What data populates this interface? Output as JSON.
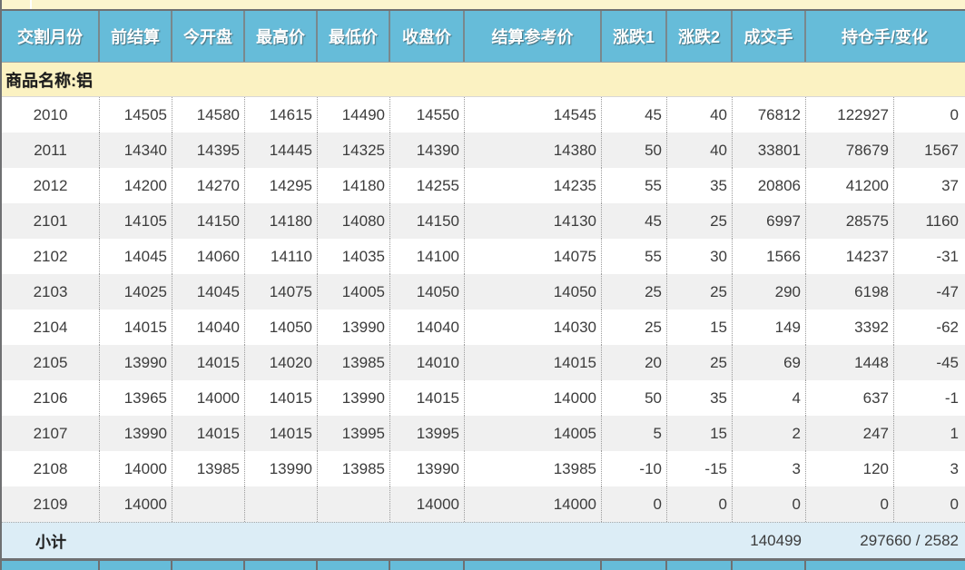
{
  "table": {
    "columns": [
      "交割月份",
      "前结算",
      "今开盘",
      "最高价",
      "最低价",
      "收盘价",
      "结算参考价",
      "涨跌1",
      "涨跌2",
      "成交手",
      "持仓手/变化"
    ],
    "product_label": "商品名称:铝",
    "rows": [
      {
        "month": "2010",
        "prev_settle": "14505",
        "open": "14580",
        "high": "14615",
        "low": "14490",
        "close": "14550",
        "settle_ref": "14545",
        "change1": "45",
        "change2": "40",
        "volume": "76812",
        "open_interest": "122927",
        "oi_change": "0"
      },
      {
        "month": "2011",
        "prev_settle": "14340",
        "open": "14395",
        "high": "14445",
        "low": "14325",
        "close": "14390",
        "settle_ref": "14380",
        "change1": "50",
        "change2": "40",
        "volume": "33801",
        "open_interest": "78679",
        "oi_change": "1567"
      },
      {
        "month": "2012",
        "prev_settle": "14200",
        "open": "14270",
        "high": "14295",
        "low": "14180",
        "close": "14255",
        "settle_ref": "14235",
        "change1": "55",
        "change2": "35",
        "volume": "20806",
        "open_interest": "41200",
        "oi_change": "37"
      },
      {
        "month": "2101",
        "prev_settle": "14105",
        "open": "14150",
        "high": "14180",
        "low": "14080",
        "close": "14150",
        "settle_ref": "14130",
        "change1": "45",
        "change2": "25",
        "volume": "6997",
        "open_interest": "28575",
        "oi_change": "1160"
      },
      {
        "month": "2102",
        "prev_settle": "14045",
        "open": "14060",
        "high": "14110",
        "low": "14035",
        "close": "14100",
        "settle_ref": "14075",
        "change1": "55",
        "change2": "30",
        "volume": "1566",
        "open_interest": "14237",
        "oi_change": "-31"
      },
      {
        "month": "2103",
        "prev_settle": "14025",
        "open": "14045",
        "high": "14075",
        "low": "14005",
        "close": "14050",
        "settle_ref": "14050",
        "change1": "25",
        "change2": "25",
        "volume": "290",
        "open_interest": "6198",
        "oi_change": "-47"
      },
      {
        "month": "2104",
        "prev_settle": "14015",
        "open": "14040",
        "high": "14050",
        "low": "13990",
        "close": "14040",
        "settle_ref": "14030",
        "change1": "25",
        "change2": "15",
        "volume": "149",
        "open_interest": "3392",
        "oi_change": "-62"
      },
      {
        "month": "2105",
        "prev_settle": "13990",
        "open": "14015",
        "high": "14020",
        "low": "13985",
        "close": "14010",
        "settle_ref": "14015",
        "change1": "20",
        "change2": "25",
        "volume": "69",
        "open_interest": "1448",
        "oi_change": "-45"
      },
      {
        "month": "2106",
        "prev_settle": "13965",
        "open": "14000",
        "high": "14015",
        "low": "13990",
        "close": "14015",
        "settle_ref": "14000",
        "change1": "50",
        "change2": "35",
        "volume": "4",
        "open_interest": "637",
        "oi_change": "-1"
      },
      {
        "month": "2107",
        "prev_settle": "13990",
        "open": "14015",
        "high": "14015",
        "low": "13995",
        "close": "13995",
        "settle_ref": "14005",
        "change1": "5",
        "change2": "15",
        "volume": "2",
        "open_interest": "247",
        "oi_change": "1"
      },
      {
        "month": "2108",
        "prev_settle": "14000",
        "open": "13985",
        "high": "13990",
        "low": "13985",
        "close": "13990",
        "settle_ref": "13985",
        "change1": "-10",
        "change2": "-15",
        "volume": "3",
        "open_interest": "120",
        "oi_change": "3"
      },
      {
        "month": "2109",
        "prev_settle": "14000",
        "open": "",
        "high": "",
        "low": "",
        "close": "14000",
        "settle_ref": "14000",
        "change1": "0",
        "change2": "0",
        "volume": "0",
        "open_interest": "0",
        "oi_change": "0"
      }
    ],
    "subtotal": {
      "label": "小计",
      "volume": "140499",
      "open_interest_change": "297660 / 2582"
    }
  },
  "colors": {
    "header_teal": "#66BCD9",
    "product_banner_yellow": "#FBF2C2",
    "top_strip_cream": "#FCF5CE",
    "alt_row_gray": "#F0F0F0",
    "subtotal_blue": "#DCEDF6",
    "border_dark_gray": "#6F7072",
    "text_dark": "#3C3C3C"
  }
}
